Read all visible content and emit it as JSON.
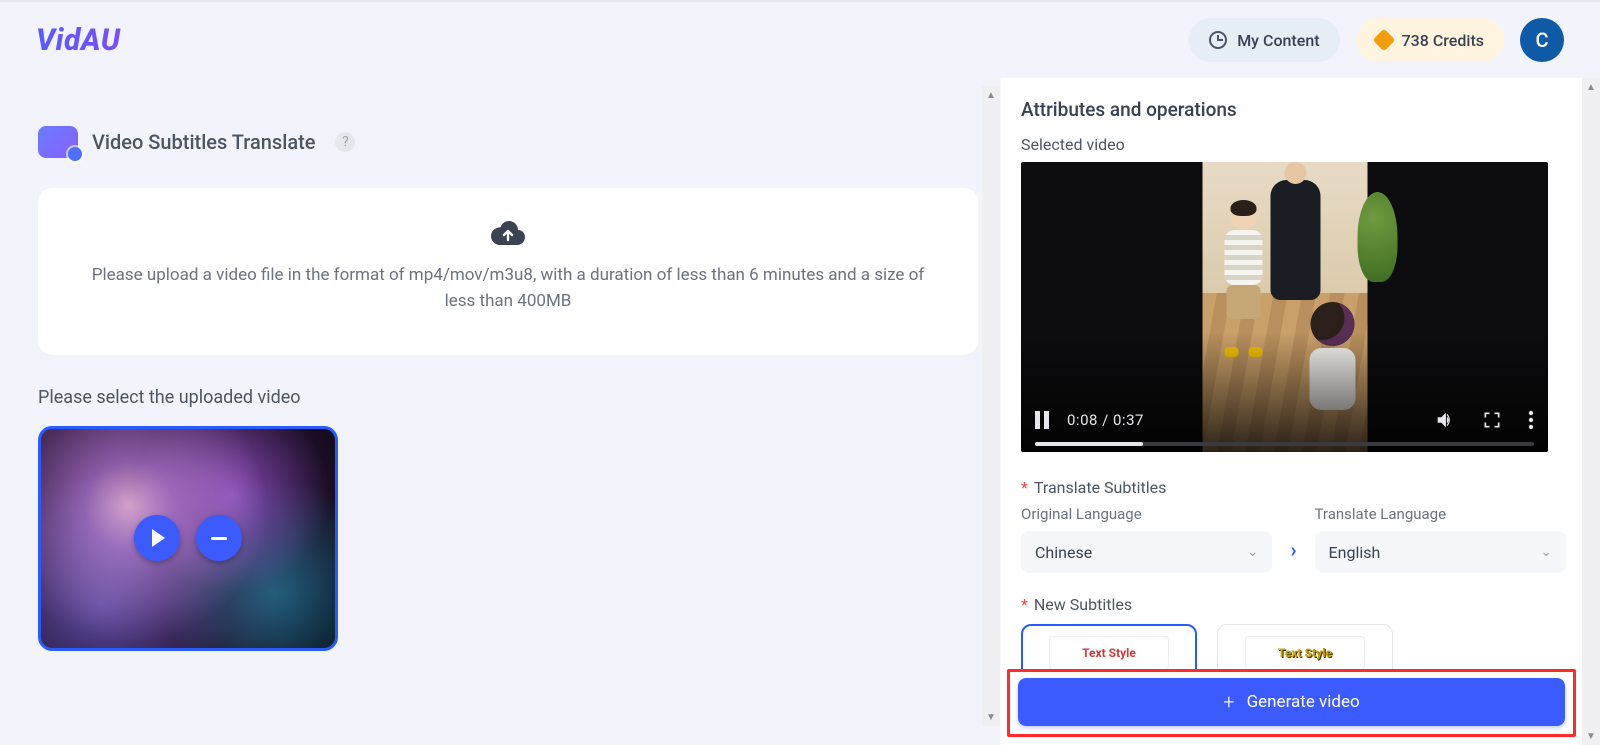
{
  "header": {
    "logo": "VidAU",
    "my_content": "My Content",
    "credits": "738 Credits",
    "avatar_initial": "C"
  },
  "left": {
    "title": "Video Subtitles Translate",
    "help": "?",
    "upload_text": "Please upload a video file in the format of mp4/mov/m3u8, with a duration of less than 6 minutes and a size of less than 400MB",
    "select_label": "Please select the uploaded video"
  },
  "right": {
    "attr_title": "Attributes and operations",
    "selected_video": "Selected video",
    "video": {
      "time": "0:08 / 0:37",
      "progress_pct": 21.6
    },
    "translate": {
      "section": "Translate Subtitles",
      "orig_label": "Original Language",
      "trans_label": "Translate Language",
      "orig_value": "Chinese",
      "trans_value": "English"
    },
    "new_subs": {
      "section": "New Subtitles",
      "style1": "Text Style",
      "style2": "Text Style"
    },
    "generate": "Generate video"
  }
}
